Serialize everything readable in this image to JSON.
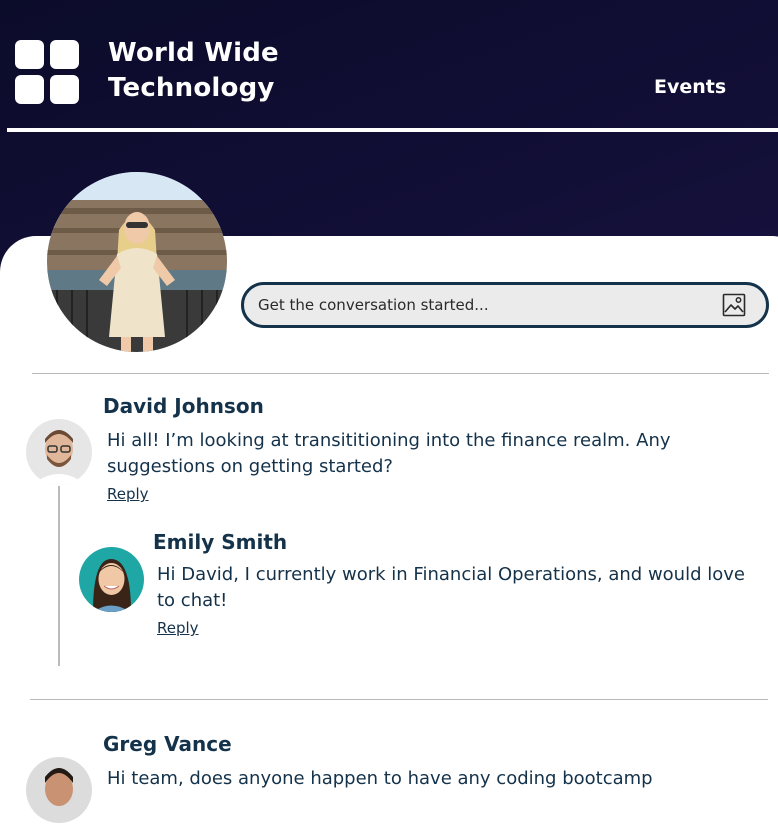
{
  "header": {
    "brand_line1": "World Wide",
    "brand_line2": "Technology",
    "nav": {
      "events_label": "Events"
    }
  },
  "composer": {
    "placeholder": "Get the conversation started..."
  },
  "comments": [
    {
      "author": "David Johnson",
      "text": "Hi all! I’m looking at transititioning into the finance realm. Any suggestions on getting started?",
      "reply_label": "Reply",
      "replies": [
        {
          "author": "Emily Smith",
          "text": "Hi David, I currently work in Financial Operations, and would love to chat!",
          "reply_label": "Reply"
        }
      ]
    },
    {
      "author": "Greg Vance",
      "text": "Hi team, does anyone happen to have any coding bootcamp"
    }
  ],
  "colors": {
    "header_bg": "#14103a",
    "text_navy": "#14324a",
    "composer_bg": "#ebebeb"
  }
}
